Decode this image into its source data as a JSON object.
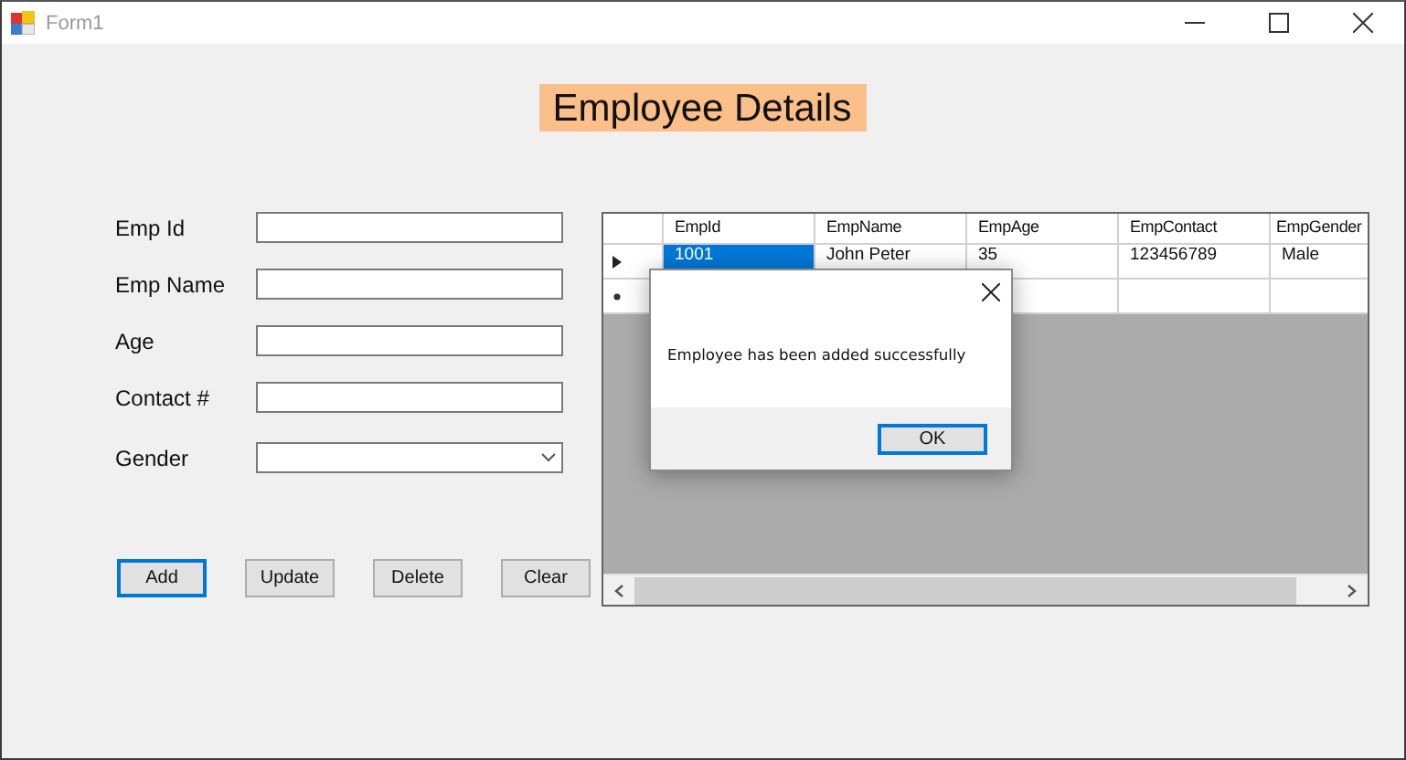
{
  "window": {
    "title": "Form1"
  },
  "heading": "Employee Details",
  "fields": [
    {
      "label": "Emp Id",
      "kind": "text"
    },
    {
      "label": "Emp Name",
      "kind": "text"
    },
    {
      "label": "Age",
      "kind": "text"
    },
    {
      "label": "Contact #",
      "kind": "text"
    },
    {
      "label": "Gender",
      "kind": "dropdown"
    }
  ],
  "buttons": [
    {
      "label": "Add",
      "focused": true
    },
    {
      "label": "Update",
      "focused": false
    },
    {
      "label": "Delete",
      "focused": false
    },
    {
      "label": "Clear",
      "focused": false
    }
  ],
  "grid": {
    "columns": [
      "EmpId",
      "EmpName",
      "EmpAge",
      "EmpContact",
      "EmpGender"
    ],
    "rows": [
      {
        "kind": "data",
        "current": true,
        "cells": [
          {
            "text": "1001",
            "selected": true
          },
          {
            "text": "John Peter",
            "selected": false
          },
          {
            "text": "35",
            "selected": false
          },
          {
            "text": "123456789",
            "selected": false
          },
          {
            "text": "Male",
            "selected": false
          }
        ]
      },
      {
        "kind": "new"
      }
    ]
  },
  "dialog": {
    "message": "Employee has been added successfully",
    "buttons": [
      {
        "label": "OK",
        "focused": true
      }
    ]
  }
}
